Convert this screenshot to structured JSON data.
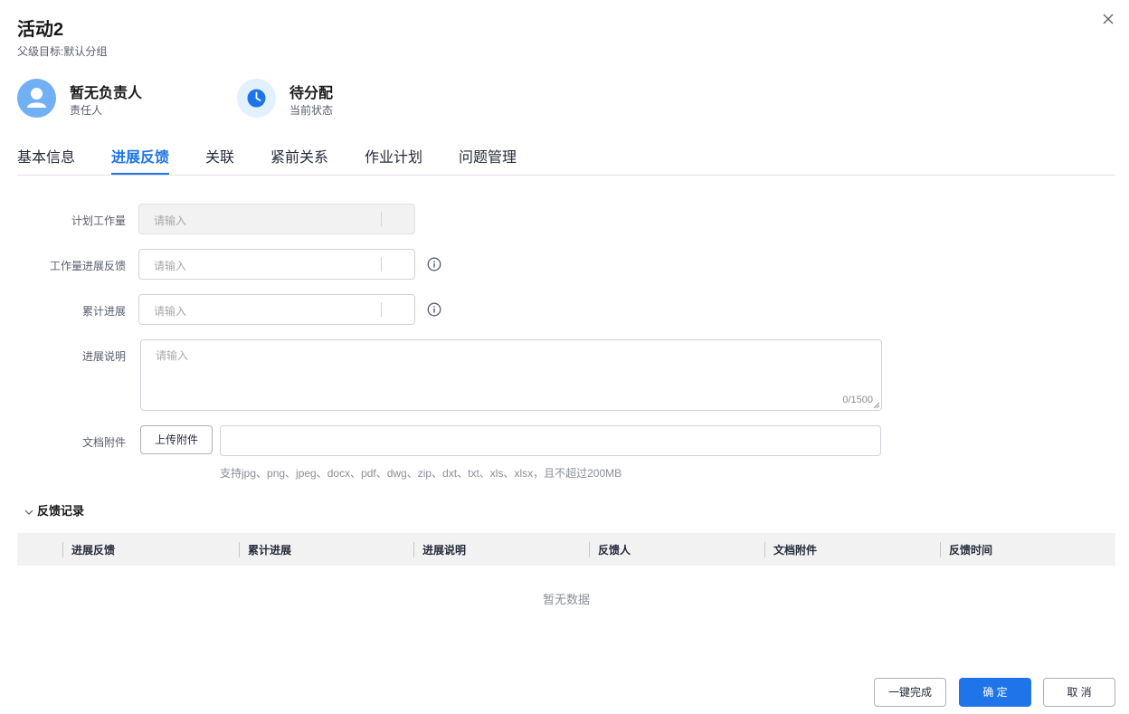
{
  "header": {
    "title": "活动2",
    "subtitle": "父级目标:默认分组"
  },
  "meta": {
    "owner": {
      "value": "暂无负责人",
      "label": "责任人",
      "icon": "user-avatar-icon"
    },
    "status": {
      "value": "待分配",
      "label": "当前状态",
      "icon": "clock-icon"
    }
  },
  "tabs": [
    {
      "label": "基本信息"
    },
    {
      "label": "进展反馈",
      "active": true
    },
    {
      "label": "关联"
    },
    {
      "label": "紧前关系"
    },
    {
      "label": "作业计划"
    },
    {
      "label": "问题管理"
    }
  ],
  "form": {
    "planned_workload": {
      "label": "计划工作量",
      "placeholder": "请输入",
      "value": "",
      "disabled": true
    },
    "workload_feedback": {
      "label": "工作量进展反馈",
      "placeholder": "请输入",
      "value": ""
    },
    "cumulative_progress": {
      "label": "累计进展",
      "placeholder": "请输入",
      "value": ""
    },
    "progress_note": {
      "label": "进展说明",
      "placeholder": "请输入",
      "counter": "0/1500"
    },
    "attachment": {
      "label": "文档附件",
      "upload_label": "上传附件",
      "hint": "支持jpg、png、jpeg、docx、pdf、dwg、zip、dxt、txt、xls、xlsx，且不超过200MB"
    }
  },
  "records": {
    "title": "反馈记录",
    "expanded": true,
    "columns": [
      "进展反馈",
      "累计进展",
      "进展说明",
      "反馈人",
      "文档附件",
      "反馈时间"
    ],
    "rows": [],
    "empty_text": "暂无数据"
  },
  "footer": {
    "complete_label": "一键完成",
    "confirm_label": "确 定",
    "cancel_label": "取 消"
  },
  "colors": {
    "accent": "#1e74e8",
    "avatar_user": "#71b0f4",
    "avatar_clock_bg": "#e3f0ff"
  }
}
